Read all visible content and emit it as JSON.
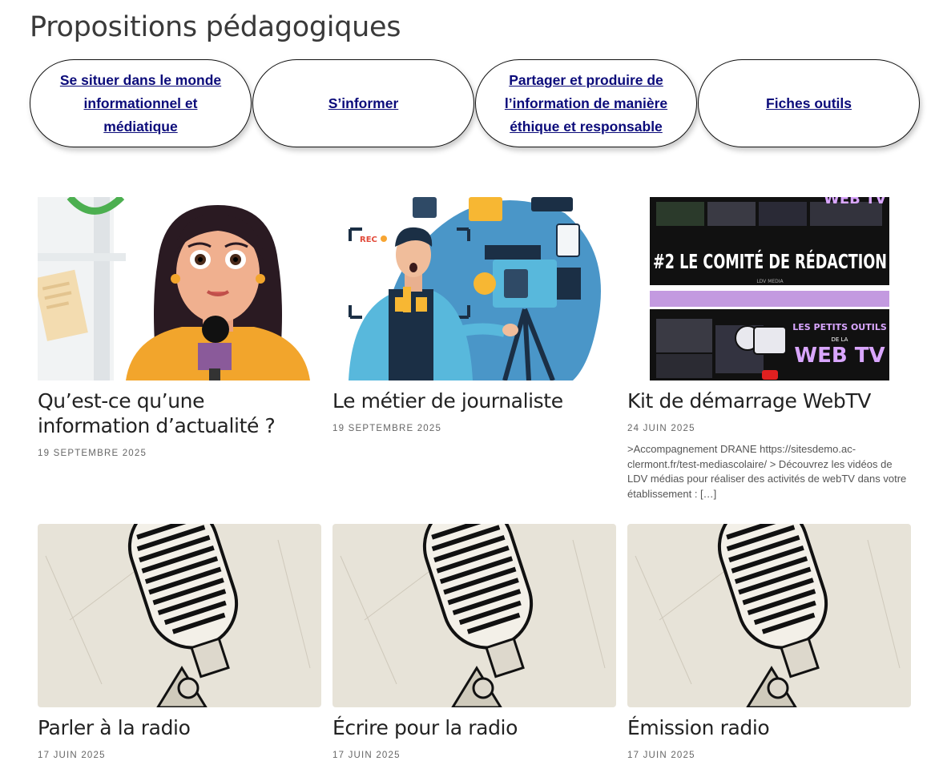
{
  "page_title": "Propositions pédagogiques",
  "nav": {
    "pill_1": "Se situer dans le monde informationnel et médiatique",
    "pill_2": "S’informer",
    "pill_3": "Partager et produire de l’information de manière éthique et responsable",
    "pill_4": "Fiches outils"
  },
  "cards": [
    {
      "title": "Qu’est-ce qu’une information d’actualité ?",
      "date": "19 septembre 2025",
      "excerpt": ""
    },
    {
      "title": "Le métier de journaliste",
      "date": "19 septembre 2025",
      "excerpt": ""
    },
    {
      "title": "Kit de démarrage WebTV",
      "date": "24 juin 2025",
      "excerpt": ">Accompagnement DRANE https://sitesdemo.ac-clermont.fr/test-mediascolaire/ > Découvrez les vidéos de LDV médias pour réaliser des activités de webTV dans votre établissement : […]"
    },
    {
      "title": "Parler à la radio",
      "date": "17 juin 2025",
      "excerpt": ""
    },
    {
      "title": "Écrire pour la radio",
      "date": "17 juin 2025",
      "excerpt": ""
    },
    {
      "title": "Émission radio",
      "date": "17 juin 2025",
      "excerpt": ""
    }
  ],
  "webtv_image": {
    "banner_text": "#2 LE COMITÉ DE RÉDACTION",
    "brand": "LDV MEDIA",
    "logo_text_1": "WEB TV",
    "logo_text_2": "LES PETITS OUTILS",
    "logo_text_3": "DE LA",
    "logo_text_4": "WEB TV"
  },
  "journalist_image": {
    "rec_label": "REC"
  },
  "colors": {
    "link": "#0b0b7a",
    "webtv_purple": "#b98be0",
    "banner_bg": "#111111",
    "radio_bg": "#e7e3d8"
  }
}
